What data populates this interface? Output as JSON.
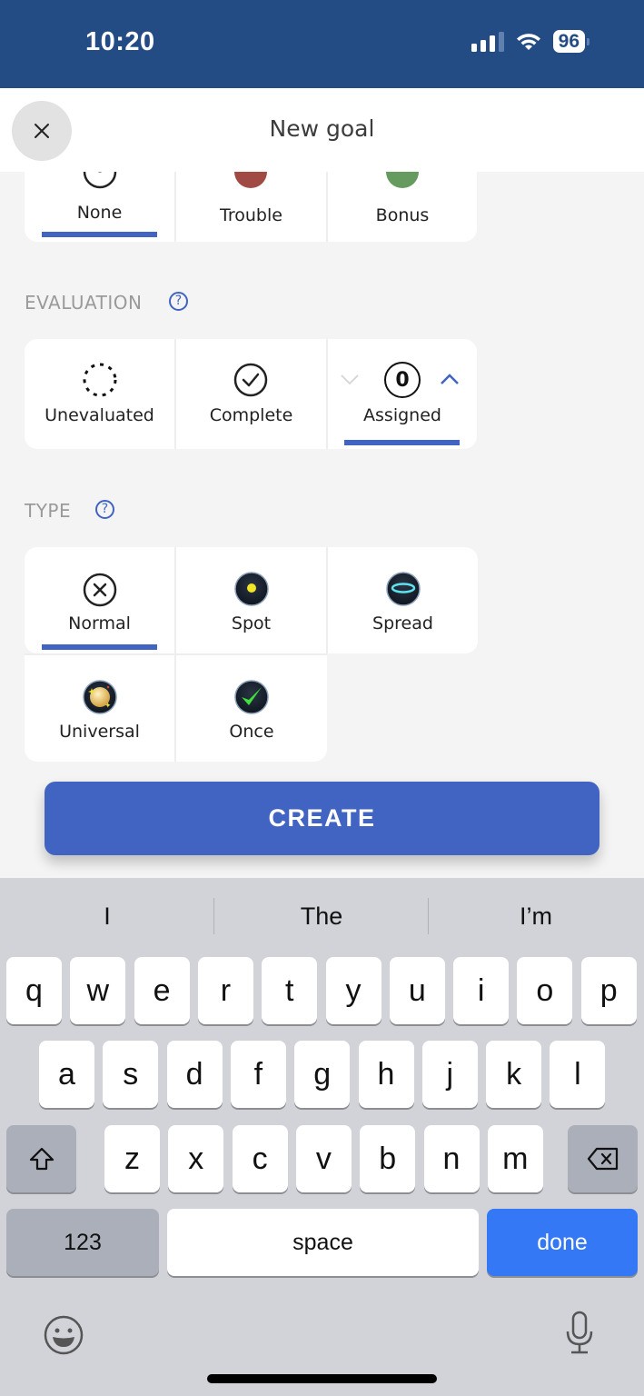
{
  "status_bar": {
    "time": "10:20",
    "battery_percent": "96",
    "signal_bars_active": 3,
    "signal_bars_total": 4,
    "icons": [
      "signal-icon",
      "wifi-icon",
      "battery-icon"
    ]
  },
  "header": {
    "title": "New goal",
    "close_icon": "close-icon"
  },
  "difficulty": {
    "options": [
      {
        "label": "None",
        "icon": "none-circle-icon",
        "selected": true
      },
      {
        "label": "Trouble",
        "icon": "trouble-red-dot-icon",
        "color": "#a14a44",
        "selected": false
      },
      {
        "label": "Bonus",
        "icon": "bonus-green-dot-icon",
        "color": "#659b5e",
        "selected": false
      }
    ]
  },
  "evaluation": {
    "section_label": "EVALUATION",
    "help_icon": "help-icon",
    "options": [
      {
        "label": "Unevaluated",
        "icon": "dashed-circle-icon",
        "selected": false
      },
      {
        "label": "Complete",
        "icon": "check-circle-icon",
        "selected": false
      },
      {
        "label": "Assigned",
        "icon": "counter-icon",
        "count": "0",
        "selected": true
      }
    ]
  },
  "type": {
    "section_label": "TYPE",
    "help_icon": "help-icon",
    "options": [
      {
        "label": "Normal",
        "icon": "x-circle-icon",
        "selected": true
      },
      {
        "label": "Spot",
        "icon": "spot-icon",
        "selected": false
      },
      {
        "label": "Spread",
        "icon": "spread-icon",
        "selected": false
      },
      {
        "label": "Universal",
        "icon": "universal-icon",
        "selected": false
      },
      {
        "label": "Once",
        "icon": "once-check-icon",
        "selected": false
      }
    ]
  },
  "create_button": {
    "label": "CREATE"
  },
  "colors": {
    "accent": "#4163c1",
    "status_bar": "#244c84",
    "keyboard_bg": "#d1d3d8",
    "done_key": "#3478f6"
  },
  "keyboard": {
    "suggestions": [
      "I",
      "The",
      "I’m"
    ],
    "row1": [
      "q",
      "w",
      "e",
      "r",
      "t",
      "y",
      "u",
      "i",
      "o",
      "p"
    ],
    "row2": [
      "a",
      "s",
      "d",
      "f",
      "g",
      "h",
      "j",
      "k",
      "l"
    ],
    "row3": [
      "z",
      "x",
      "c",
      "v",
      "b",
      "n",
      "m"
    ],
    "numbers_key": "123",
    "space_key": "space",
    "done_key": "done"
  }
}
